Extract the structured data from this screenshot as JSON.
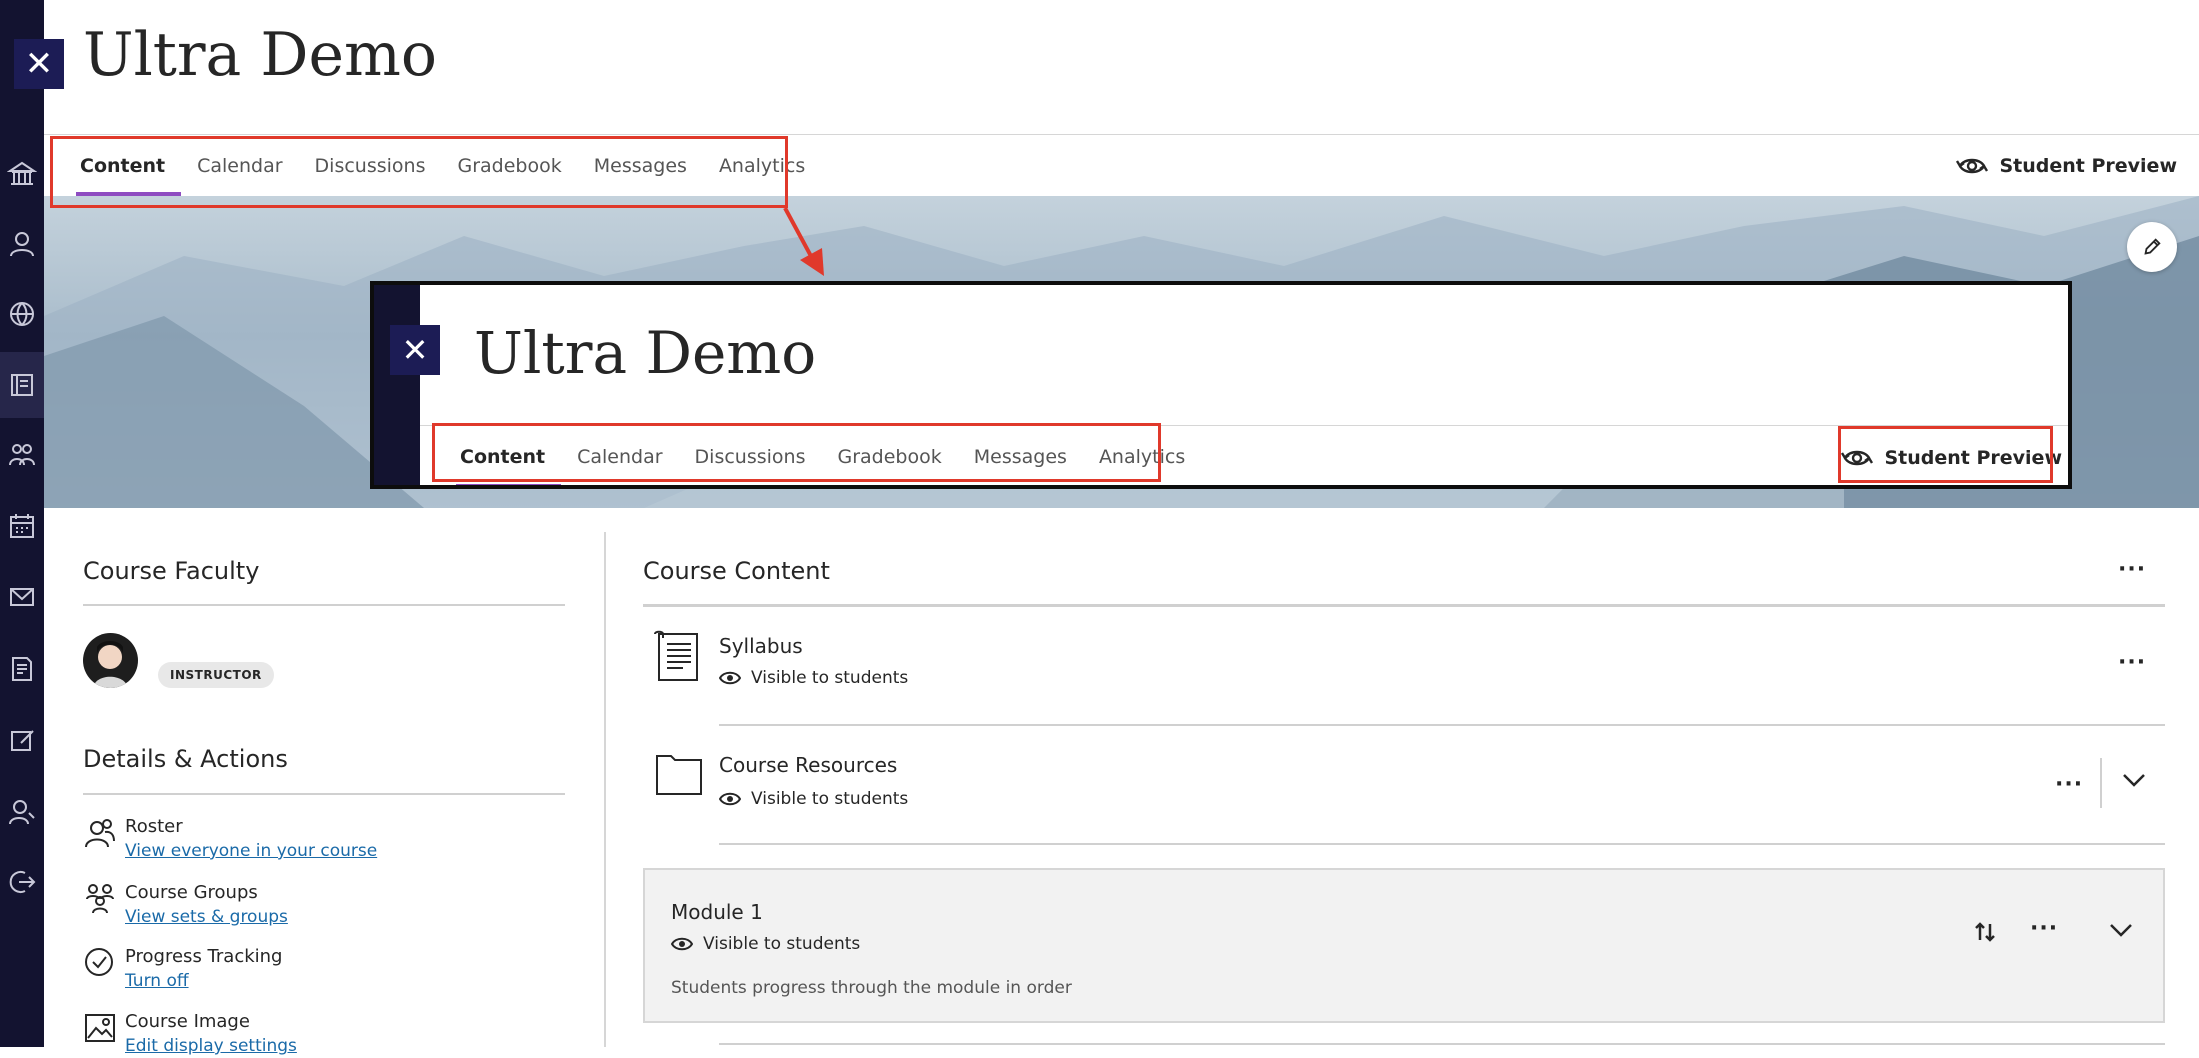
{
  "course": {
    "title": "Ultra Demo",
    "close_glyph": "✕"
  },
  "nav": {
    "tabs": [
      {
        "label": "Content",
        "active": true
      },
      {
        "label": "Calendar"
      },
      {
        "label": "Discussions"
      },
      {
        "label": "Gradebook"
      },
      {
        "label": "Messages"
      },
      {
        "label": "Analytics"
      }
    ],
    "student_preview_label": "Student Preview"
  },
  "inset": {
    "title": "Ultra Demo",
    "tabs": [
      "Content",
      "Calendar",
      "Discussions",
      "Gradebook",
      "Messages",
      "Analytics"
    ],
    "student_preview_label": "Student Preview"
  },
  "course_faculty": {
    "title": "Course Faculty",
    "role_badge": "INSTRUCTOR"
  },
  "details": {
    "title": "Details & Actions",
    "items": [
      {
        "label": "Roster",
        "link": "View everyone in your course",
        "icon": "roster-icon"
      },
      {
        "label": "Course Groups",
        "link": "View sets & groups",
        "icon": "groups-icon"
      },
      {
        "label": "Progress Tracking",
        "link": "Turn off",
        "icon": "check-circle-icon"
      },
      {
        "label": "Course Image",
        "link": "Edit display settings",
        "icon": "image-icon"
      }
    ]
  },
  "course_content": {
    "title": "Course Content",
    "more_glyph": "···",
    "items": [
      {
        "title": "Syllabus",
        "visibility": "Visible to students",
        "icon": "document-icon"
      },
      {
        "title": "Course Resources",
        "visibility": "Visible to students",
        "icon": "folder-icon"
      }
    ],
    "module": {
      "title": "Module 1",
      "visibility": "Visible to students",
      "description": "Students progress through the module in order"
    }
  },
  "colors": {
    "accent": "#8e4cc1",
    "rail": "#131330",
    "highlight": "#e0392b",
    "link": "#1a6aa8"
  }
}
